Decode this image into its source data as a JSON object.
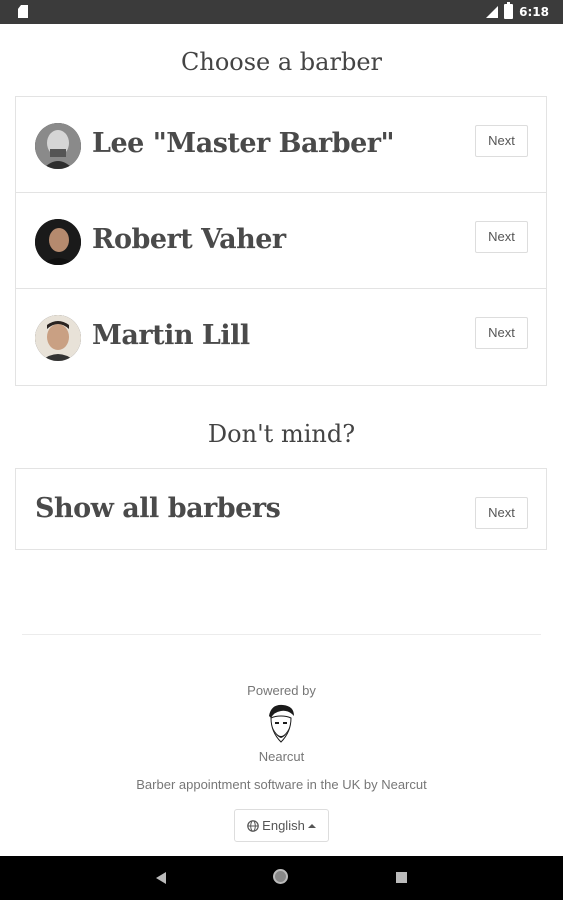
{
  "status_bar": {
    "time": "6:18"
  },
  "page": {
    "title": "Choose a barber",
    "barbers": [
      {
        "name": "Lee \"Master Barber\"",
        "action": "Next"
      },
      {
        "name": "Robert Vaher",
        "action": "Next"
      },
      {
        "name": "Martin Lill",
        "action": "Next"
      }
    ],
    "dont_mind_heading": "Don't mind?",
    "show_all": {
      "label": "Show all barbers",
      "action": "Next"
    }
  },
  "footer": {
    "powered_by": "Powered by",
    "brand": "Nearcut",
    "tagline": "Barber appointment software in the UK by Nearcut",
    "language": "English"
  },
  "colors": {
    "text": "#444444",
    "border": "#e3e3e3",
    "status_bar": "#3b3b3b"
  }
}
